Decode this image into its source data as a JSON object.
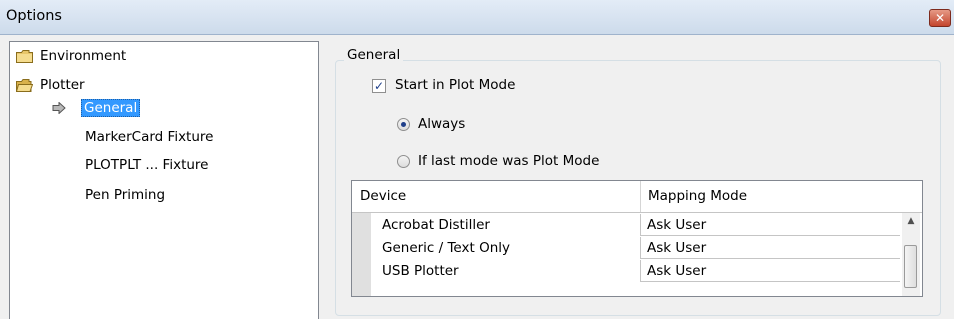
{
  "window": {
    "title": "Options",
    "close_glyph": "✕"
  },
  "tree": {
    "nodes": [
      {
        "label": "Environment",
        "icon": "folder-closed-icon"
      },
      {
        "label": "Plotter",
        "icon": "folder-open-icon"
      },
      {
        "label": "General",
        "selected": true,
        "icon": "arrow-right-icon"
      },
      {
        "label": "MarkerCard Fixture"
      },
      {
        "label": "PLOTPLT ... Fixture"
      },
      {
        "label": "Pen Priming"
      }
    ]
  },
  "general": {
    "group_title": "General",
    "start_in_plot_mode": {
      "label": "Start in Plot Mode",
      "checked": true,
      "check_glyph": "✓"
    },
    "radio_always": {
      "label": "Always",
      "selected": true
    },
    "radio_last_mode": {
      "label": "If last mode was Plot Mode",
      "selected": false
    }
  },
  "device_table": {
    "columns": [
      "Device",
      "Mapping Mode"
    ],
    "rows": [
      {
        "device": "Acrobat Distiller",
        "mapping_mode": "Ask User"
      },
      {
        "device": "Generic / Text Only",
        "mapping_mode": "Ask User"
      },
      {
        "device": "USB Plotter",
        "mapping_mode": "Ask User"
      }
    ],
    "scroll_up_glyph": "▲"
  },
  "colors": {
    "selection": "#3399ff",
    "title_bar": "#cddbeb",
    "close_button": "#c4452d",
    "folder": "#e8c66a"
  }
}
